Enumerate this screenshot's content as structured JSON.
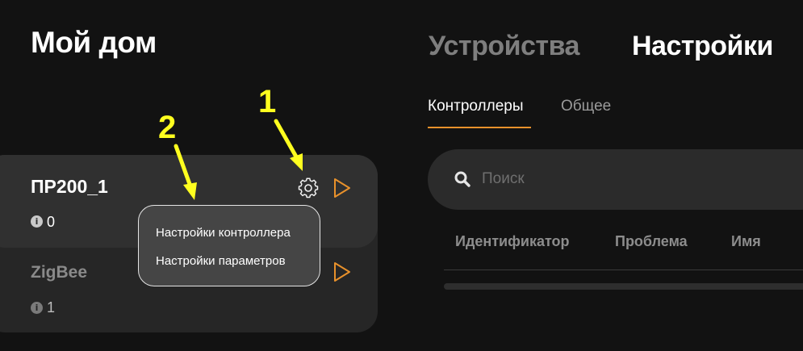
{
  "home": {
    "title": "Мой дом"
  },
  "nav": {
    "tabs": [
      {
        "label": "Устройства"
      },
      {
        "label": "Настройки"
      }
    ]
  },
  "subnav": {
    "tabs": [
      {
        "label": "Контроллеры"
      },
      {
        "label": "Общее"
      }
    ]
  },
  "search": {
    "placeholder": "Поиск"
  },
  "table": {
    "columns": [
      "Идентификатор",
      "Проблема",
      "Имя"
    ]
  },
  "controllers": [
    {
      "name": "ПР200_1",
      "count": "0"
    },
    {
      "name": "ZigBee",
      "count": "1"
    }
  ],
  "context_menu": {
    "items": [
      "Настройки контроллера",
      "Настройки параметров"
    ]
  },
  "annotations": [
    "1",
    "2"
  ],
  "colors": {
    "accent": "#e8912b",
    "annotation": "#ffff1f",
    "background": "#121212"
  },
  "icons": [
    "search-icon",
    "gear-icon",
    "play-icon",
    "info-icon"
  ]
}
